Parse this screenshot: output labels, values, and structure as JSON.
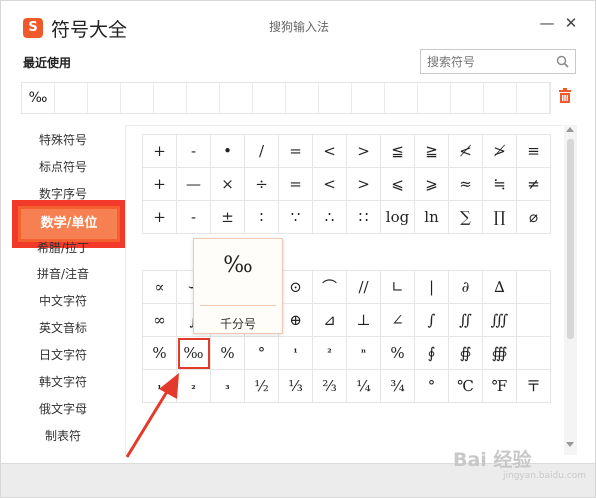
{
  "title": {
    "logo_char": "S",
    "app_title": "符号大全",
    "ime_name": "搜狗输入法",
    "minimize": "—",
    "close": "✕"
  },
  "recent": {
    "title": "最近使用",
    "items": [
      "‰",
      "",
      "",
      "",
      "",
      "",
      "",
      "",
      "",
      "",
      "",
      "",
      "",
      "",
      "",
      ""
    ]
  },
  "search": {
    "placeholder": "搜索符号"
  },
  "sidebar": {
    "items": [
      {
        "label": "特殊符号"
      },
      {
        "label": "标点符号"
      },
      {
        "label": "数字序号"
      },
      {
        "label": "数学/单位"
      },
      {
        "label": "希腊/拉丁"
      },
      {
        "label": "拼音/注音"
      },
      {
        "label": "中文字符"
      },
      {
        "label": "英文音标"
      },
      {
        "label": "日文字符"
      },
      {
        "label": "韩文字符"
      },
      {
        "label": "俄文字母"
      },
      {
        "label": "制表符"
      }
    ],
    "active_index": 3
  },
  "grid_top": [
    [
      "+",
      "-",
      "•",
      "/",
      "=",
      "<",
      ">",
      "≦",
      "≧",
      "≮",
      "≯",
      "≡"
    ],
    [
      "+",
      "—",
      "×",
      "÷",
      "=",
      "<",
      ">",
      "⩽",
      "⩾",
      "≈",
      "≒",
      "≠"
    ],
    [
      "+",
      "-",
      "±",
      "∶",
      "∵",
      "∴",
      "∷",
      "log",
      "ln",
      "∑",
      "∏",
      "⌀"
    ]
  ],
  "grid_bottom": [
    [
      "∝",
      "∽",
      "",
      "∧",
      "⊙",
      "⌒",
      "//",
      "∟",
      "|",
      "∂",
      "∆"
    ],
    [
      "∞",
      "∫",
      "",
      "∨",
      "⊕",
      "⊿",
      "⊥",
      "∠",
      "∫",
      "∬",
      "∭"
    ],
    [
      "%",
      "‰",
      "%",
      "°",
      "¹",
      "²",
      "ⁿ",
      "%",
      "∮",
      "∯",
      "∰"
    ],
    [
      "₁",
      "₂",
      "₃",
      "½",
      "⅓",
      "⅔",
      "¼",
      "¾",
      "°",
      "℃",
      "℉",
      "〒"
    ]
  ],
  "preview": {
    "glyph": "‰",
    "name": "千分号"
  },
  "watermark": {
    "text": "Bai 经验",
    "sub": "jingyan.baidu.com"
  },
  "colors": {
    "accent": "#f46030",
    "highlight": "#e43a2c"
  }
}
